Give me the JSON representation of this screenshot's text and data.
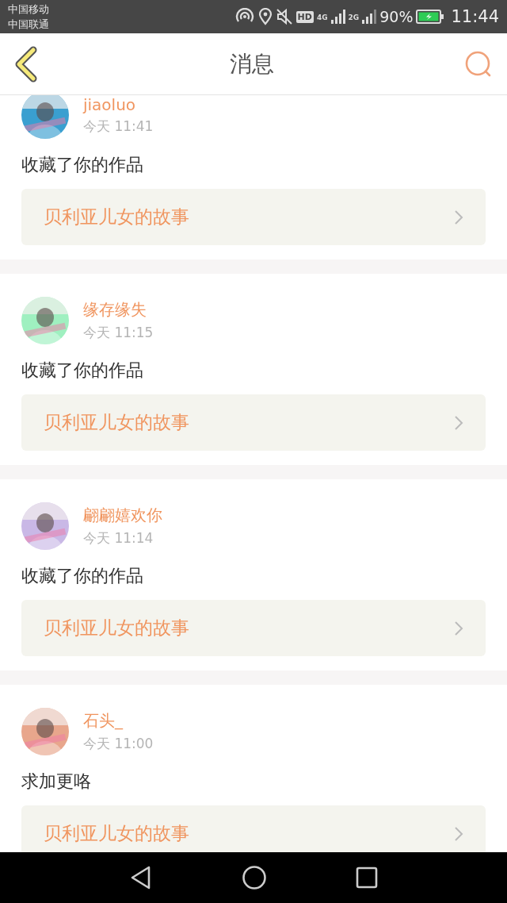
{
  "status_bar": {
    "carriers": [
      "中国移动",
      "中国联通"
    ],
    "hd_badge": "HD",
    "network_labels": [
      "4G",
      "2G"
    ],
    "battery": "90%",
    "time": "11:44"
  },
  "header": {
    "title": "消息"
  },
  "messages": [
    {
      "user": "jiaoluo",
      "time": "今天 11:41",
      "action": "收藏了你的作品",
      "work": "贝利亚儿女的故事"
    },
    {
      "user": "缘存缘失",
      "time": "今天 11:15",
      "action": "收藏了你的作品",
      "work": "贝利亚儿女的故事"
    },
    {
      "user": "翩翩嬉欢你",
      "time": "今天 11:14",
      "action": "收藏了你的作品",
      "work": "贝利亚儿女的故事"
    },
    {
      "user": "石头_",
      "time": "今天 11:00",
      "action": "求加更咯",
      "work": "贝利亚儿女的故事"
    }
  ]
}
